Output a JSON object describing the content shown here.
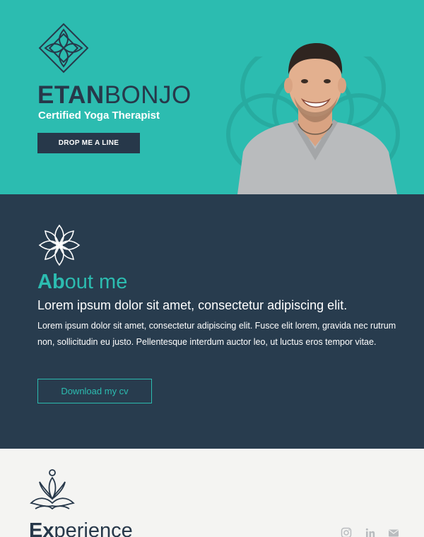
{
  "hero": {
    "name_first": "ETAN",
    "name_last": "BONJO",
    "subtitle": "Certified Yoga Therapist",
    "cta_label": "DROP ME A LINE",
    "logo_icon": "lotus-diamond-logo-icon",
    "portrait_icon": "person-portrait"
  },
  "about": {
    "title_bold": "Ab",
    "title_rest": "out me",
    "lead": "Lorem ipsum dolor sit amet, consectetur adipiscing elit.",
    "body": "Lorem ipsum dolor sit amet, consectetur adipiscing elit. Fusce elit lorem, gravida nec rutrum non, sollicitudin eu justo. Pellentesque interdum auctor leo, ut luctus eros tempor vitae.",
    "cv_label": "Download my cv",
    "icon": "mandala-flower-icon"
  },
  "experience": {
    "title_bold": "Ex",
    "title_rest": "perience",
    "icon": "meditation-lotus-icon"
  },
  "social": {
    "icons": [
      "instagram-icon",
      "linkedin-icon",
      "mail-icon"
    ]
  },
  "colors": {
    "teal": "#2cbcb0",
    "navy": "#283c4e",
    "dark_text": "#27384a",
    "light_bg": "#f4f4f2",
    "white": "#ffffff"
  }
}
